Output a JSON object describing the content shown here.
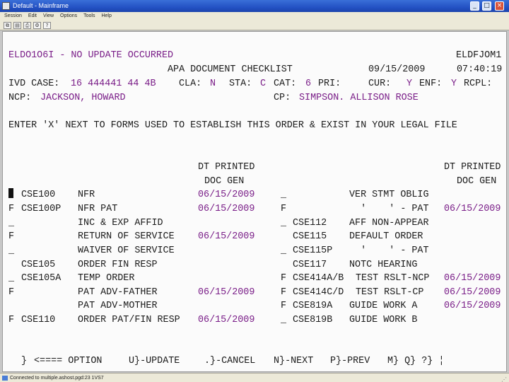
{
  "window": {
    "title": "Default - Mainframe"
  },
  "menu": [
    "Session",
    "Edit",
    "View",
    "Options",
    "Tools",
    "Help"
  ],
  "toolbar": [
    "copy-icon",
    "paste-icon",
    "print-icon",
    "settings-icon",
    "help-icon"
  ],
  "screen": {
    "message": "ELDO1O6I - NO UPDATE OCCURRED",
    "screen_id": "ELDFJOM1",
    "title": "APA DOCUMENT CHECKLIST",
    "date": "09/15/2009",
    "time": "07:40:19",
    "ivd_label": "IVD CASE:",
    "ivd_value": "16 444441 44 4B",
    "cla_label": "CLA:",
    "cla_value": "N",
    "sta_label": "STA:",
    "sta_value": "C",
    "cat_label": "CAT:",
    "cat_value": "6",
    "pri_label": "PRI:",
    "cur_label": "CUR:",
    "cur_value": "Y",
    "enf_label": "ENF:",
    "enf_value": "Y",
    "rcpl_label": "RCPL:",
    "ncp_label": "NCP:",
    "ncp_value": "JACKSON, HOWARD",
    "cp_label": "CP:",
    "cp_value": "SIMPSON. ALLISON ROSE",
    "instruction": "ENTER 'X' NEXT TO FORMS USED TO ESTABLISH THIS ORDER & EXIST IN YOUR LEGAL FILE",
    "col_header_1": "DT PRINTED",
    "col_header_2": "DOC GEN",
    "left_rows": [
      {
        "sel": "",
        "form": "CSE100",
        "desc": "NFR",
        "date": "06/15/2009"
      },
      {
        "sel": "F",
        "form": "CSE100P",
        "desc": "NFR PAT",
        "date": "06/15/2009"
      },
      {
        "sel": "_",
        "form": "",
        "desc": "INC & EXP AFFID",
        "date": ""
      },
      {
        "sel": "F",
        "form": "",
        "desc": "RETURN OF SERVICE",
        "date": "06/15/2009"
      },
      {
        "sel": "_",
        "form": "",
        "desc": "WAIVER OF SERVICE",
        "date": ""
      },
      {
        "sel": "",
        "form": "CSE105",
        "desc": "ORDER FIN RESP",
        "date": ""
      },
      {
        "sel": "_",
        "form": "CSE105A",
        "desc": "TEMP ORDER",
        "date": ""
      },
      {
        "sel": "F",
        "form": "",
        "desc": "PAT ADV-FATHER",
        "date": "06/15/2009"
      },
      {
        "sel": "",
        "form": "",
        "desc": "PAT ADV-MOTHER",
        "date": ""
      },
      {
        "sel": "F",
        "form": "CSE110",
        "desc": "ORDER PAT/FIN RESP",
        "date": "06/15/2009"
      }
    ],
    "right_rows": [
      {
        "sel": "_",
        "form": "",
        "desc": "VER STMT OBLIG",
        "date": ""
      },
      {
        "sel": "F",
        "form": "",
        "desc": "  '    ' - PAT",
        "date": "06/15/2009"
      },
      {
        "sel": "_",
        "form": "CSE112",
        "desc": "AFF NON-APPEAR",
        "date": ""
      },
      {
        "sel": "",
        "form": "CSE115",
        "desc": "DEFAULT ORDER",
        "date": ""
      },
      {
        "sel": "_",
        "form": "CSE115P",
        "desc": "  '    ' - PAT",
        "date": ""
      },
      {
        "sel": "",
        "form": "CSE117",
        "desc": "NOTC HEARING",
        "date": ""
      },
      {
        "sel": "F",
        "form": "CSE414A/B",
        "desc": "TEST RSLT-NCP",
        "date": "06/15/2009"
      },
      {
        "sel": "F",
        "form": "CSE414C/D",
        "desc": "TEST RSLT-CP",
        "date": "06/15/2009"
      },
      {
        "sel": "F",
        "form": "CSE819A",
        "desc": "GUIDE WORK A",
        "date": "06/15/2009"
      },
      {
        "sel": "_",
        "form": "CSE819B",
        "desc": "GUIDE WORK B",
        "date": ""
      }
    ],
    "option_field": "}",
    "option_label": "<==== OPTION",
    "pf_update": "U}-UPDATE",
    "pf_cancel": ".}-CANCEL",
    "pf_next": "N}-NEXT",
    "pf_prev": "P}-PREV",
    "pf_misc": "M} Q} ?} ¦"
  },
  "status": {
    "text": "Connected to multiple.ashost.pgd:23 1VS7"
  }
}
